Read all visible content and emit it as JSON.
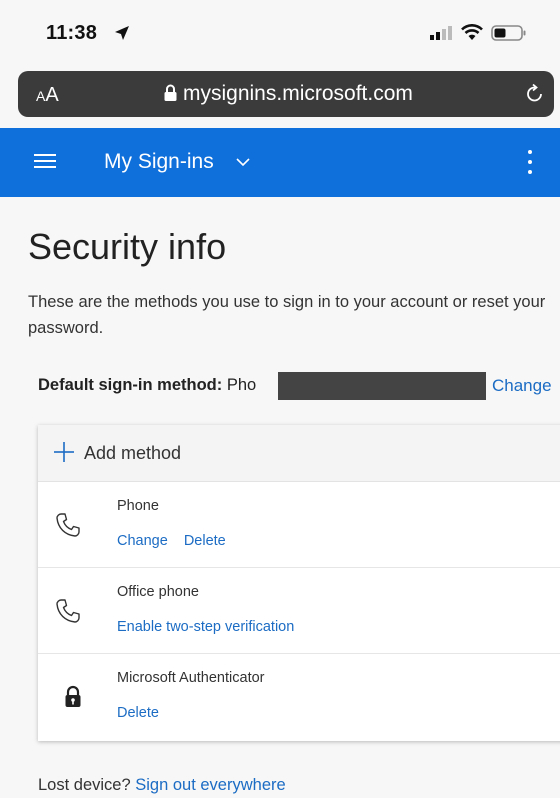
{
  "status_bar": {
    "time": "11:38",
    "icons": [
      "location-arrow-icon",
      "signal-icon",
      "wifi-icon",
      "battery-icon"
    ]
  },
  "browser": {
    "text_size_button": {
      "small": "A",
      "large": "A"
    },
    "url": "mysignins.microsoft.com",
    "icons": [
      "lock-icon",
      "reload-icon"
    ]
  },
  "app_header": {
    "title": "My Sign-ins",
    "background_color": "#0f6fdb",
    "icons": [
      "menu-icon",
      "chevron-down-icon",
      "more-options-icon"
    ]
  },
  "page": {
    "title": "Security info",
    "description": "These are the methods you use to sign in to your account or reset your password.",
    "default_method": {
      "label": "Default sign-in method:",
      "value_visible": "Pho",
      "change_label": "Change"
    },
    "add_method_label": "Add method",
    "methods": [
      {
        "name": "Phone",
        "icon": "phone-icon",
        "links": [
          "Change",
          "Delete"
        ]
      },
      {
        "name": "Office phone",
        "icon": "phone-icon",
        "links": [
          "Enable two-step verification"
        ]
      },
      {
        "name": "Microsoft Authenticator",
        "icon": "authenticator-lock-icon",
        "links": [
          "Delete"
        ]
      }
    ],
    "lost_device": {
      "text": "Lost device?",
      "link": "Sign out everywhere"
    }
  },
  "colors": {
    "accent": "#0f6fdb",
    "link": "#1c6cc4",
    "urlbar": "#3b3b3b"
  }
}
